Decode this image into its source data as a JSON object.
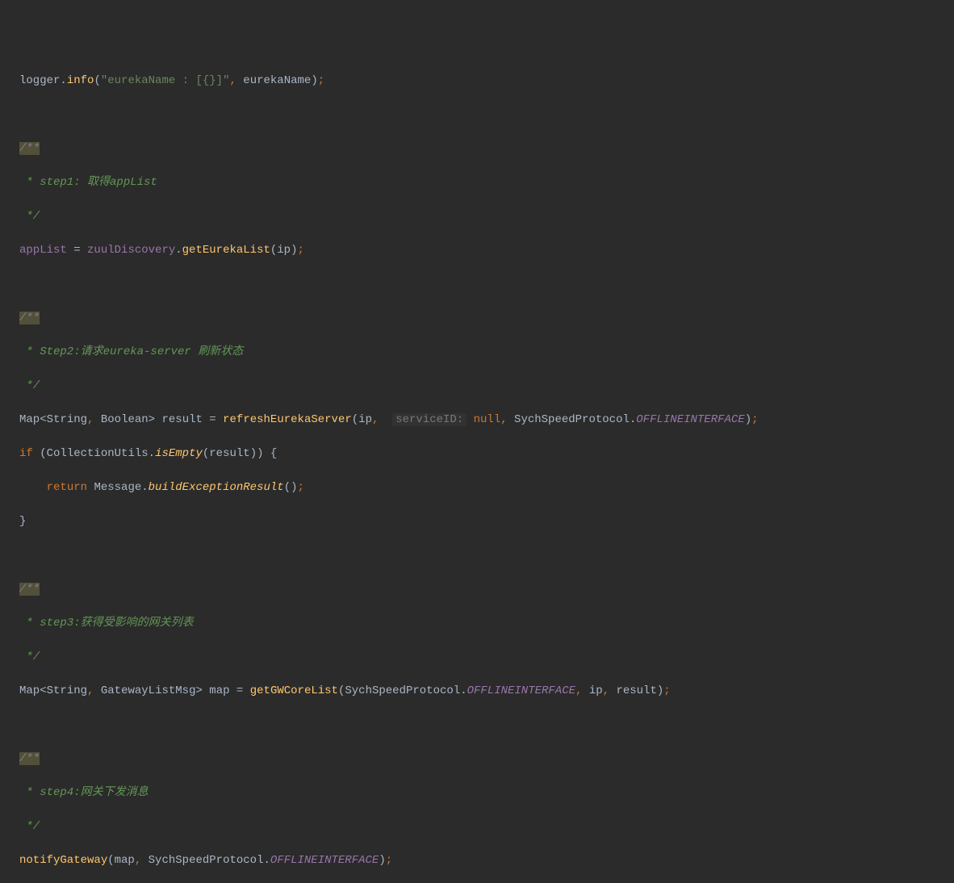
{
  "lines": {
    "l1_logger": "logger",
    "l1_info": "info",
    "l1_str": "\"eurekaName : [{}]\"",
    "l1_arg": "eurekaName",
    "doc1_open": "/**",
    "doc1_body": " * step1: 取得appList",
    "doc1_close": " */",
    "l2_applist": "appList",
    "l2_zuul": "zuulDiscovery",
    "l2_method": "getEurekaList",
    "l2_arg": "ip",
    "doc2_open": "/**",
    "doc2_body": " * Step2:请求eureka-server 刷新状态",
    "doc2_close": " */",
    "l3_map": "Map",
    "l3_string": "String",
    "l3_bool": "Boolean",
    "l3_result": "result",
    "l3_refresh": "refreshEurekaServer",
    "l3_ip": "ip",
    "l3_hint": "serviceID:",
    "l3_null": "null",
    "l3_proto": "SychSpeedProtocol",
    "l3_const": "OFFLINEINTERFACE",
    "l4_if": "if",
    "l4_cu": "CollectionUtils",
    "l4_isEmpty": "isEmpty",
    "l4_result": "result",
    "l5_return": "return",
    "l5_msg": "Message",
    "l5_build": "buildExceptionResult",
    "doc3_open": "/**",
    "doc3_body": " * step3:获得受影响的网关列表",
    "doc3_close": " */",
    "l6_map": "Map",
    "l6_string": "String",
    "l6_gwtype": "GatewayListMsg",
    "l6_mapvar": "map",
    "l6_method": "getGWCoreList",
    "l6_proto": "SychSpeedProtocol",
    "l6_const": "OFFLINEINTERFACE",
    "l6_ip": "ip",
    "l6_result": "result",
    "doc4_open": "/**",
    "doc4_body": " * step4:网关下发消息",
    "doc4_close": " */",
    "l7_method": "notifyGateway",
    "l7_map": "map",
    "l7_proto": "SychSpeedProtocol",
    "l7_const": "OFFLINEINTERFACE"
  }
}
